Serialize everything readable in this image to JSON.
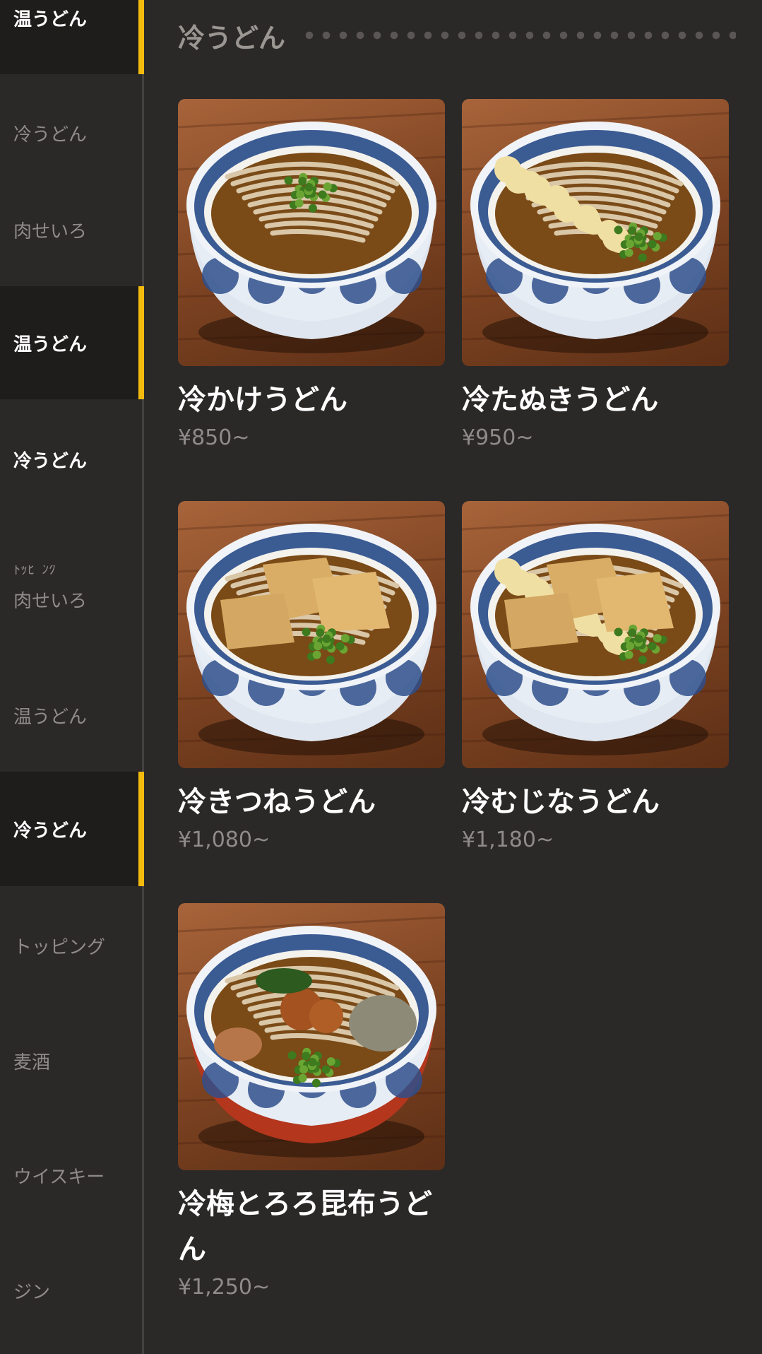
{
  "sidebar": {
    "items": [
      {
        "label": "温うどん",
        "active": true
      },
      {
        "label": "冷うどん",
        "active": false
      },
      {
        "label": "肉せいろ",
        "active": false
      },
      {
        "label": "温うどん",
        "active": true
      },
      {
        "label": "冷うどん",
        "active": false
      },
      {
        "label": "肉せいろ",
        "active": false
      },
      {
        "label": "温うどん",
        "active": false
      },
      {
        "label": "冷うどん",
        "active": true
      },
      {
        "label": "トッピング",
        "active": false
      },
      {
        "label": "麦酒",
        "active": false
      },
      {
        "label": "ウイスキー",
        "active": false
      },
      {
        "label": "ジン",
        "active": false
      }
    ],
    "accent_color": "#f2bb0d"
  },
  "section": {
    "title": "冷うどん"
  },
  "menu": [
    {
      "name": "冷かけうどん",
      "price": "¥850~",
      "icon": "kake-udon-photo"
    },
    {
      "name": "冷たぬきうどん",
      "price": "¥950~",
      "icon": "tanuki-udon-photo"
    },
    {
      "name": "冷きつねうどん",
      "price": "¥1,080~",
      "icon": "kitsune-udon-photo"
    },
    {
      "name": "冷むじなうどん",
      "price": "¥1,180~",
      "icon": "mujina-udon-photo"
    },
    {
      "name": "冷梅とろろ昆布うどん",
      "price": "¥1,250~",
      "icon": "ume-tororo-udon-photo"
    }
  ]
}
